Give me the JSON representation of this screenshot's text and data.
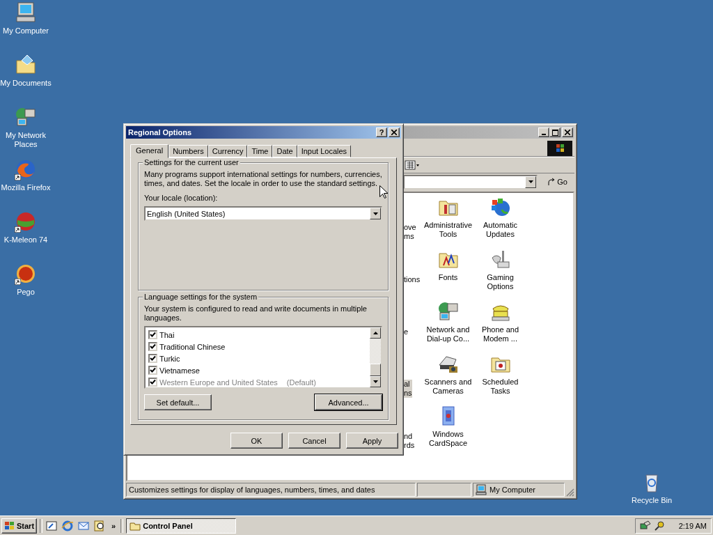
{
  "desktop_icons": [
    {
      "label": "My Computer",
      "kind": "computer",
      "shortcut": false
    },
    {
      "label": "My Documents",
      "kind": "documents",
      "shortcut": false
    },
    {
      "label": "My Network Places",
      "kind": "network",
      "shortcut": false
    },
    {
      "label": "Mozilla Firefox",
      "kind": "firefox",
      "shortcut": true
    },
    {
      "label": "K-Meleon 74",
      "kind": "meleon",
      "shortcut": true
    },
    {
      "label": "Pego",
      "kind": "pego",
      "shortcut": true
    }
  ],
  "recycle_bin": {
    "label": "Recycle Bin"
  },
  "control_panel": {
    "go_label": "Go",
    "rows": [
      {
        "partial": {
          "lines": [
            "ove",
            "ms"
          ],
          "selected": false
        },
        "items": [
          {
            "kind": "admin",
            "lines": [
              "Administrative",
              "Tools"
            ]
          },
          {
            "kind": "updates",
            "lines": [
              "Automatic",
              "Updates"
            ]
          }
        ]
      },
      {
        "partial": {
          "lines": [
            "tions"
          ],
          "selected": false
        },
        "items": [
          {
            "kind": "fonts",
            "lines": [
              "Fonts"
            ]
          },
          {
            "kind": "gaming",
            "lines": [
              "Gaming",
              "Options"
            ]
          }
        ]
      },
      {
        "partial": {
          "lines": [
            "e"
          ],
          "selected": false
        },
        "items": [
          {
            "kind": "network",
            "lines": [
              "Network and",
              "Dial-up Co..."
            ]
          },
          {
            "kind": "phone",
            "lines": [
              "Phone and",
              "Modem ..."
            ]
          }
        ]
      },
      {
        "partial": {
          "lines": [
            "al",
            "ns"
          ],
          "selected": true
        },
        "items": [
          {
            "kind": "scanner",
            "lines": [
              "Scanners and",
              "Cameras"
            ]
          },
          {
            "kind": "tasks",
            "lines": [
              "Scheduled",
              "Tasks"
            ]
          }
        ]
      },
      {
        "partial": {
          "lines": [
            "nd",
            "rds"
          ],
          "selected": false
        },
        "items": [
          {
            "kind": "cardspace",
            "lines": [
              "Windows",
              "CardSpace"
            ]
          }
        ]
      }
    ],
    "status_bar": {
      "text": "Customizes settings for display of languages, numbers, times, and dates",
      "zone": "My Computer"
    }
  },
  "dialog": {
    "title": "Regional Options",
    "help_button": "?",
    "tabs": [
      {
        "label": "General",
        "selected": true
      },
      {
        "label": "Numbers",
        "selected": false
      },
      {
        "label": "Currency",
        "selected": false
      },
      {
        "label": "Time",
        "selected": false
      },
      {
        "label": "Date",
        "selected": false
      },
      {
        "label": "Input Locales",
        "selected": false
      }
    ],
    "user_group": {
      "legend": "Settings for the current user",
      "description": "Many programs support international settings for numbers, currencies, times, and dates. Set the locale in order to use the standard settings.",
      "locale_label": "Your locale (location):",
      "locale_value": "English (United States)"
    },
    "system_group": {
      "legend": "Language settings for the system",
      "description": "Your system is configured to read and write documents in multiple languages.",
      "languages": [
        {
          "label": "Thai",
          "checked": true,
          "disabled": false
        },
        {
          "label": "Traditional Chinese",
          "checked": true,
          "disabled": false
        },
        {
          "label": "Turkic",
          "checked": true,
          "disabled": false
        },
        {
          "label": "Vietnamese",
          "checked": true,
          "disabled": false
        },
        {
          "label": "Western Europe and United States",
          "note": "(Default)",
          "checked": true,
          "disabled": true
        }
      ],
      "buttons": [
        {
          "label": "Set default...",
          "default": false
        },
        {
          "label": "Advanced...",
          "default": true
        }
      ]
    },
    "buttons": [
      {
        "label": "OK",
        "default": false
      },
      {
        "label": "Cancel",
        "default": false
      },
      {
        "label": "Apply",
        "default": false
      }
    ]
  },
  "taskbar": {
    "start": "Start",
    "quick_launch": [
      {
        "kind": "desktop"
      },
      {
        "kind": "ie"
      },
      {
        "kind": "outlook"
      },
      {
        "kind": "search"
      }
    ],
    "chevron": "»",
    "tasks": [
      {
        "label": "Control Panel",
        "selected": true
      }
    ],
    "clock": "2:19 AM"
  }
}
